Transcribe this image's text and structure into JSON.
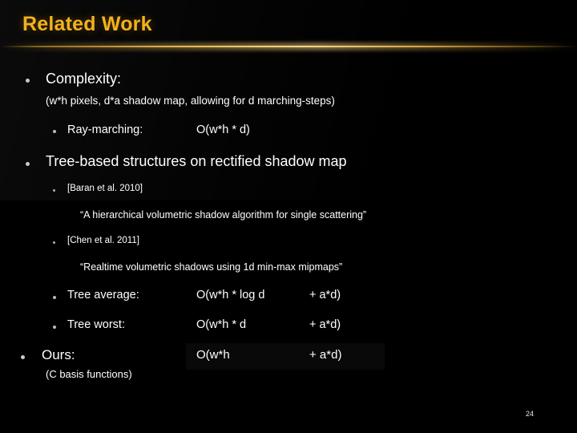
{
  "slide": {
    "title": "Related Work",
    "page_number": "24",
    "accent_color": "#f2b11f",
    "text_color": "#ffffff",
    "background_color": "#000000"
  },
  "sections": {
    "complexity": {
      "heading": "Complexity:",
      "note": "(w*h pixels, d*a shadow map, allowing for d marching-steps)",
      "ray_marching": {
        "label": "Ray-marching:",
        "formula": "O(w*h * d)"
      }
    },
    "tree_based": {
      "heading": "Tree-based structures on rectified shadow map",
      "citations": [
        {
          "reference": "[Baran et al. 2010]",
          "quote": "“A hierarchical volumetric shadow algorithm for single scattering”"
        },
        {
          "reference": "[Chen et al. 2011]",
          "quote": "“Realtime volumetric shadows using 1d min-max mipmaps”"
        }
      ],
      "rows": [
        {
          "label": "Tree average:",
          "formula_main": "O(w*h * log d",
          "formula_extra": "+ a*d)"
        },
        {
          "label": "Tree worst:",
          "formula_main": "O(w*h * d",
          "formula_extra": "+ a*d)"
        }
      ]
    },
    "ours": {
      "heading": "Ours:",
      "note": "(C basis functions)",
      "formula_main": "O(w*h",
      "formula_extra": "+ a*d)"
    }
  }
}
